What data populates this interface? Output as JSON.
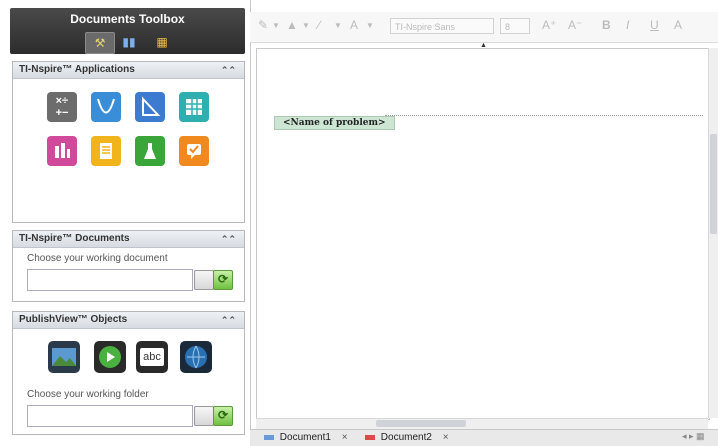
{
  "toolbox": {
    "title": "Documents Toolbox",
    "tabs": [
      {
        "icon": "tools-icon",
        "active": true
      },
      {
        "icon": "book-icon",
        "active": false
      },
      {
        "icon": "folder-icon",
        "active": false
      }
    ]
  },
  "apps_panel": {
    "title": "TI-Nspire™ Applications",
    "apps": [
      {
        "icon": "calculator-icon",
        "color": "#6c6c6c"
      },
      {
        "icon": "graphs-icon",
        "color": "#3a8ed8"
      },
      {
        "icon": "geometry-icon",
        "color": "#3d7bd0"
      },
      {
        "icon": "spreadsheet-icon",
        "color": "#2fb0b0"
      },
      {
        "icon": "data-stats-icon",
        "color": "#d0499a"
      },
      {
        "icon": "notes-icon",
        "color": "#f2b41c"
      },
      {
        "icon": "vernier-icon",
        "color": "#3aa63a"
      },
      {
        "icon": "question-icon",
        "color": "#f08a1e"
      }
    ]
  },
  "docs_panel": {
    "title": "TI-Nspire™ Documents",
    "label": "Choose your working document"
  },
  "publish_panel": {
    "title": "PublishView™ Objects",
    "label": "Choose your working folder",
    "objects": [
      {
        "icon": "image-icon"
      },
      {
        "icon": "video-icon"
      },
      {
        "icon": "textbox-icon",
        "text": "abc"
      },
      {
        "icon": "hyperlink-icon"
      }
    ]
  },
  "toolbar": {
    "font_name": "TI-Nspire Sans",
    "font_size": "8",
    "buttons": [
      "A⁺",
      "A⁻",
      "B",
      "I",
      "U",
      "A"
    ]
  },
  "editor": {
    "problem_label": "<Name of problem>"
  },
  "tabs": {
    "documents": [
      {
        "name": "Document1",
        "color": "#6a9ad8"
      },
      {
        "name": "Document2",
        "color": "#e04848"
      }
    ]
  }
}
